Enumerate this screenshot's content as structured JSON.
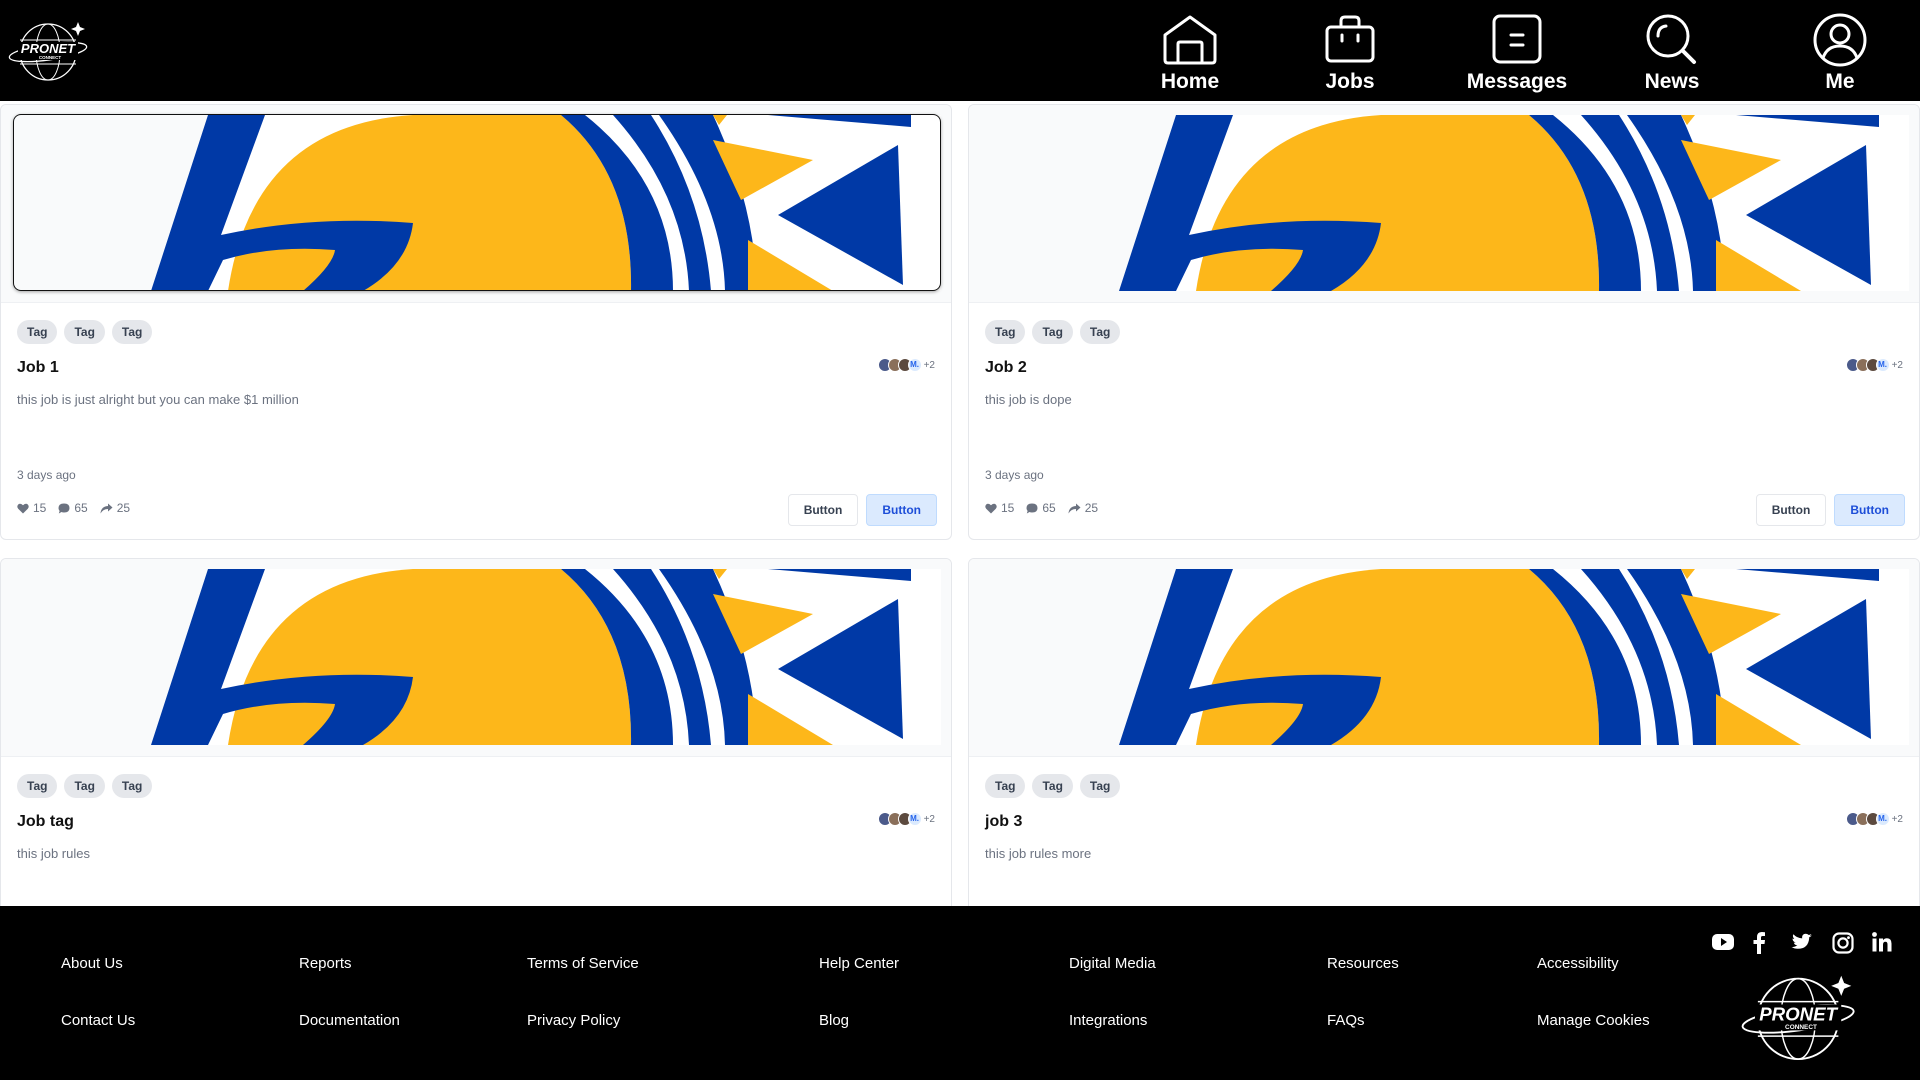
{
  "header": {
    "nav": [
      {
        "label": "Home",
        "icon": "home-icon"
      },
      {
        "label": "Jobs",
        "icon": "briefcase-icon"
      },
      {
        "label": "Messages",
        "icon": "message-icon"
      },
      {
        "label": "News",
        "icon": "search-icon"
      },
      {
        "label": "Me",
        "icon": "user-icon"
      }
    ]
  },
  "colors": {
    "header_bg": "#000000",
    "banner_blue": "#0039A6",
    "banner_gold": "#FDB71A",
    "primary_button_bg": "#DBEAFE",
    "primary_button_text": "#1D4ED8"
  },
  "cards": [
    {
      "tags": [
        "Tag",
        "Tag",
        "Tag"
      ],
      "title": "Job 1",
      "description": "this job is just alright but you can make $1 million",
      "time": "3 days ago",
      "avatar_initial": "M.",
      "avatar_more": "+2",
      "likes": "15",
      "comments": "65",
      "shares": "25",
      "secondary_button": "Button",
      "primary_button": "Button"
    },
    {
      "tags": [
        "Tag",
        "Tag",
        "Tag"
      ],
      "title": "Job 2",
      "description": "this job is dope",
      "time": "3 days ago",
      "avatar_initial": "M.",
      "avatar_more": "+2",
      "likes": "15",
      "comments": "65",
      "shares": "25",
      "secondary_button": "Button",
      "primary_button": "Button"
    },
    {
      "tags": [
        "Tag",
        "Tag",
        "Tag"
      ],
      "title": "Job tag",
      "description": "this job rules",
      "avatar_initial": "M.",
      "avatar_more": "+2"
    },
    {
      "tags": [
        "Tag",
        "Tag",
        "Tag"
      ],
      "title": "job 3",
      "description": "this job rules more",
      "avatar_initial": "M.",
      "avatar_more": "+2"
    }
  ],
  "footer": {
    "links": [
      "About Us",
      "Contact Us",
      "Reports",
      "Documentation",
      "Terms of Service",
      "Privacy Policy",
      "Help Center",
      "Blog",
      "Digital Media",
      "Integrations",
      "Resources",
      "FAQs",
      "Accessibility",
      "Manage Cookies"
    ],
    "social": [
      "youtube-icon",
      "facebook-icon",
      "twitter-icon",
      "instagram-icon",
      "linkedin-icon"
    ]
  },
  "brand": {
    "logo_text_line1": "PRONET",
    "logo_text_line2": "CONNECT"
  }
}
